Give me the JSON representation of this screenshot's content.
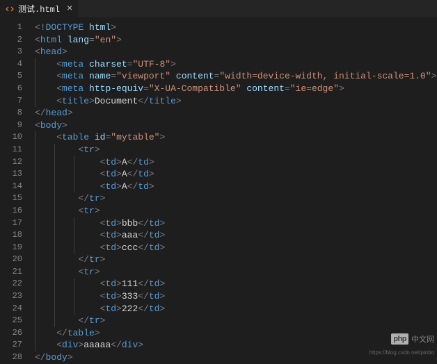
{
  "tab": {
    "filename": "测试.html",
    "close": "×"
  },
  "watermark": {
    "logo": "php",
    "text": "中文网"
  },
  "footer": {
    "url": "https://blog.csdn.net/pinbo"
  },
  "lines": [
    {
      "n": 1,
      "indent": 0,
      "guides": [],
      "tokens": [
        [
          "p",
          "<!"
        ],
        [
          "tag",
          "DOCTYPE "
        ],
        [
          "attr",
          "html"
        ],
        [
          "p",
          ">"
        ]
      ]
    },
    {
      "n": 2,
      "indent": 0,
      "guides": [],
      "tokens": [
        [
          "p",
          "<"
        ],
        [
          "tag",
          "html "
        ],
        [
          "attr",
          "lang"
        ],
        [
          "p",
          "="
        ],
        [
          "str",
          "\"en\""
        ],
        [
          "p",
          ">"
        ]
      ]
    },
    {
      "n": 3,
      "indent": 0,
      "guides": [],
      "tokens": [
        [
          "p",
          "<"
        ],
        [
          "tag",
          "head"
        ],
        [
          "p",
          ">"
        ]
      ]
    },
    {
      "n": 4,
      "indent": 1,
      "guides": [
        1
      ],
      "tokens": [
        [
          "p",
          "<"
        ],
        [
          "tag",
          "meta "
        ],
        [
          "attr",
          "charset"
        ],
        [
          "p",
          "="
        ],
        [
          "str",
          "\"UTF-8\""
        ],
        [
          "p",
          ">"
        ]
      ]
    },
    {
      "n": 5,
      "indent": 1,
      "guides": [
        1
      ],
      "tokens": [
        [
          "p",
          "<"
        ],
        [
          "tag",
          "meta "
        ],
        [
          "attr",
          "name"
        ],
        [
          "p",
          "="
        ],
        [
          "str",
          "\"viewport\""
        ],
        [
          "tag",
          " "
        ],
        [
          "attr",
          "content"
        ],
        [
          "p",
          "="
        ],
        [
          "str",
          "\"width=device-width, initial-scale=1.0\""
        ],
        [
          "p",
          ">"
        ]
      ]
    },
    {
      "n": 6,
      "indent": 1,
      "guides": [
        1
      ],
      "tokens": [
        [
          "p",
          "<"
        ],
        [
          "tag",
          "meta "
        ],
        [
          "attr",
          "http-equiv"
        ],
        [
          "p",
          "="
        ],
        [
          "str",
          "\"X-UA-Compatible\""
        ],
        [
          "tag",
          " "
        ],
        [
          "attr",
          "content"
        ],
        [
          "p",
          "="
        ],
        [
          "str",
          "\"ie=edge\""
        ],
        [
          "p",
          ">"
        ]
      ]
    },
    {
      "n": 7,
      "indent": 1,
      "guides": [
        1
      ],
      "tokens": [
        [
          "p",
          "<"
        ],
        [
          "tag",
          "title"
        ],
        [
          "p",
          ">"
        ],
        [
          "txt",
          "Document"
        ],
        [
          "p",
          "</"
        ],
        [
          "tag",
          "title"
        ],
        [
          "p",
          ">"
        ]
      ]
    },
    {
      "n": 8,
      "indent": 0,
      "guides": [],
      "tokens": [
        [
          "p",
          "</"
        ],
        [
          "tag",
          "head"
        ],
        [
          "p",
          ">"
        ]
      ]
    },
    {
      "n": 9,
      "indent": 0,
      "guides": [],
      "tokens": [
        [
          "p",
          "<"
        ],
        [
          "tag",
          "body"
        ],
        [
          "p",
          ">"
        ]
      ]
    },
    {
      "n": 10,
      "indent": 1,
      "guides": [
        1
      ],
      "tokens": [
        [
          "p",
          "<"
        ],
        [
          "tag",
          "table "
        ],
        [
          "attr",
          "id"
        ],
        [
          "p",
          "="
        ],
        [
          "str",
          "\"mytable\""
        ],
        [
          "p",
          ">"
        ]
      ]
    },
    {
      "n": 11,
      "indent": 2,
      "guides": [
        1,
        2
      ],
      "tokens": [
        [
          "p",
          "<"
        ],
        [
          "tag",
          "tr"
        ],
        [
          "p",
          ">"
        ]
      ]
    },
    {
      "n": 12,
      "indent": 3,
      "guides": [
        1,
        2,
        3
      ],
      "tokens": [
        [
          "p",
          "<"
        ],
        [
          "tag",
          "td"
        ],
        [
          "p",
          ">"
        ],
        [
          "txt",
          "A"
        ],
        [
          "p",
          "</"
        ],
        [
          "tag",
          "td"
        ],
        [
          "p",
          ">"
        ]
      ]
    },
    {
      "n": 13,
      "indent": 3,
      "guides": [
        1,
        2,
        3
      ],
      "tokens": [
        [
          "p",
          "<"
        ],
        [
          "tag",
          "td"
        ],
        [
          "p",
          ">"
        ],
        [
          "txt",
          "A"
        ],
        [
          "p",
          "</"
        ],
        [
          "tag",
          "td"
        ],
        [
          "p",
          ">"
        ]
      ]
    },
    {
      "n": 14,
      "indent": 3,
      "guides": [
        1,
        2,
        3
      ],
      "tokens": [
        [
          "p",
          "<"
        ],
        [
          "tag",
          "td"
        ],
        [
          "p",
          ">"
        ],
        [
          "txt",
          "A"
        ],
        [
          "p",
          "</"
        ],
        [
          "tag",
          "td"
        ],
        [
          "p",
          ">"
        ]
      ]
    },
    {
      "n": 15,
      "indent": 2,
      "guides": [
        1,
        2
      ],
      "tokens": [
        [
          "p",
          "</"
        ],
        [
          "tag",
          "tr"
        ],
        [
          "p",
          ">"
        ]
      ]
    },
    {
      "n": 16,
      "indent": 2,
      "guides": [
        1,
        2
      ],
      "tokens": [
        [
          "p",
          "<"
        ],
        [
          "tag",
          "tr"
        ],
        [
          "p",
          ">"
        ]
      ]
    },
    {
      "n": 17,
      "indent": 3,
      "guides": [
        1,
        2,
        3
      ],
      "tokens": [
        [
          "p",
          "<"
        ],
        [
          "tag",
          "td"
        ],
        [
          "p",
          ">"
        ],
        [
          "txt",
          "bbb"
        ],
        [
          "p",
          "</"
        ],
        [
          "tag",
          "td"
        ],
        [
          "p",
          ">"
        ]
      ]
    },
    {
      "n": 18,
      "indent": 3,
      "guides": [
        1,
        2,
        3
      ],
      "tokens": [
        [
          "p",
          "<"
        ],
        [
          "tag",
          "td"
        ],
        [
          "p",
          ">"
        ],
        [
          "txt",
          "aaa"
        ],
        [
          "p",
          "</"
        ],
        [
          "tag",
          "td"
        ],
        [
          "p",
          ">"
        ]
      ]
    },
    {
      "n": 19,
      "indent": 3,
      "guides": [
        1,
        2,
        3
      ],
      "tokens": [
        [
          "p",
          "<"
        ],
        [
          "tag",
          "td"
        ],
        [
          "p",
          ">"
        ],
        [
          "txt",
          "ccc"
        ],
        [
          "p",
          "</"
        ],
        [
          "tag",
          "td"
        ],
        [
          "p",
          ">"
        ]
      ]
    },
    {
      "n": 20,
      "indent": 2,
      "guides": [
        1,
        2
      ],
      "tokens": [
        [
          "p",
          "</"
        ],
        [
          "tag",
          "tr"
        ],
        [
          "p",
          ">"
        ]
      ]
    },
    {
      "n": 21,
      "indent": 2,
      "guides": [
        1,
        2
      ],
      "tokens": [
        [
          "p",
          "<"
        ],
        [
          "tag",
          "tr"
        ],
        [
          "p",
          ">"
        ]
      ]
    },
    {
      "n": 22,
      "indent": 3,
      "guides": [
        1,
        2,
        3
      ],
      "tokens": [
        [
          "p",
          "<"
        ],
        [
          "tag",
          "td"
        ],
        [
          "p",
          ">"
        ],
        [
          "txt",
          "111"
        ],
        [
          "p",
          "</"
        ],
        [
          "tag",
          "td"
        ],
        [
          "p",
          ">"
        ]
      ]
    },
    {
      "n": 23,
      "indent": 3,
      "guides": [
        1,
        2,
        3
      ],
      "tokens": [
        [
          "p",
          "<"
        ],
        [
          "tag",
          "td"
        ],
        [
          "p",
          ">"
        ],
        [
          "txt",
          "333"
        ],
        [
          "p",
          "</"
        ],
        [
          "tag",
          "td"
        ],
        [
          "p",
          ">"
        ]
      ]
    },
    {
      "n": 24,
      "indent": 3,
      "guides": [
        1,
        2,
        3
      ],
      "tokens": [
        [
          "p",
          "<"
        ],
        [
          "tag",
          "td"
        ],
        [
          "p",
          ">"
        ],
        [
          "txt",
          "222"
        ],
        [
          "p",
          "</"
        ],
        [
          "tag",
          "td"
        ],
        [
          "p",
          ">"
        ]
      ]
    },
    {
      "n": 25,
      "indent": 2,
      "guides": [
        1,
        2
      ],
      "tokens": [
        [
          "p",
          "</"
        ],
        [
          "tag",
          "tr"
        ],
        [
          "p",
          ">"
        ]
      ]
    },
    {
      "n": 26,
      "indent": 1,
      "guides": [
        1
      ],
      "tokens": [
        [
          "p",
          "</"
        ],
        [
          "tag",
          "table"
        ],
        [
          "p",
          ">"
        ]
      ]
    },
    {
      "n": 27,
      "indent": 1,
      "guides": [
        1
      ],
      "tokens": [
        [
          "p",
          "<"
        ],
        [
          "tag",
          "div"
        ],
        [
          "p",
          ">"
        ],
        [
          "txt",
          "aaaaa"
        ],
        [
          "p",
          "</"
        ],
        [
          "tag",
          "div"
        ],
        [
          "p",
          ">"
        ]
      ]
    },
    {
      "n": 28,
      "indent": 0,
      "guides": [],
      "tokens": [
        [
          "p",
          "</"
        ],
        [
          "tag",
          "body"
        ],
        [
          "p",
          ">"
        ]
      ]
    }
  ]
}
